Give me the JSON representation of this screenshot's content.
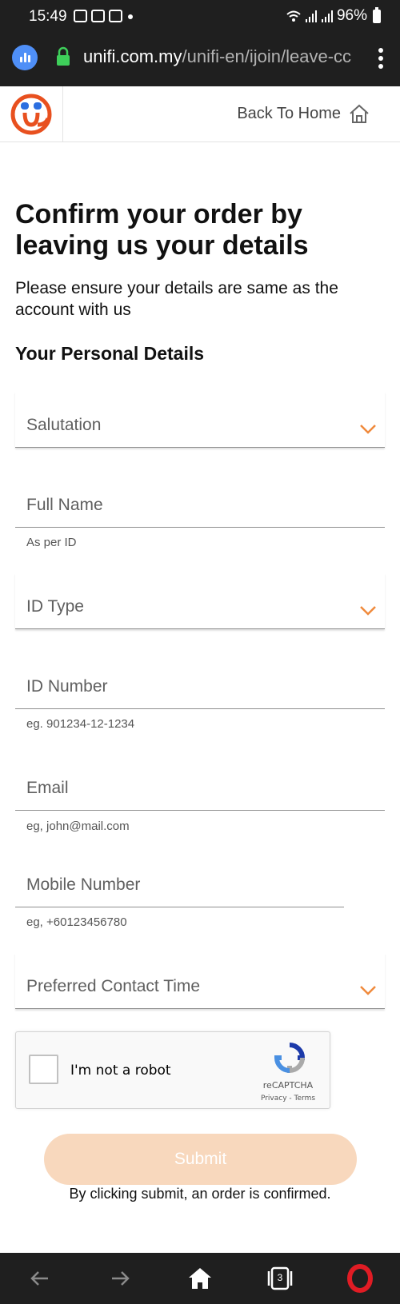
{
  "status_bar": {
    "time": "15:49",
    "battery": "96%"
  },
  "browser": {
    "url_domain": "unifi.com.my",
    "url_path": "/unifi-en/ijoin/leave-cc",
    "tab_count": "3"
  },
  "header": {
    "back_home_label": "Back To Home"
  },
  "page": {
    "title": "Confirm your order by leaving us your details",
    "subtitle": "Please ensure your details are same as the account with us",
    "section_heading": "Your Personal Details"
  },
  "form": {
    "salutation_placeholder": "Salutation",
    "full_name_placeholder": "Full Name",
    "full_name_helper": "As per ID",
    "id_type_placeholder": "ID Type",
    "id_number_placeholder": "ID Number",
    "id_number_helper": "eg. 901234-12-1234",
    "email_placeholder": "Email",
    "email_helper": "eg, john@mail.com",
    "mobile_placeholder": "Mobile Number",
    "mobile_helper": "eg, +60123456780",
    "contact_time_placeholder": "Preferred Contact Time"
  },
  "recaptcha": {
    "label": "I'm not a robot",
    "brand": "reCAPTCHA",
    "privacy": "Privacy",
    "separator": " - ",
    "terms": "Terms"
  },
  "submit_label": "Submit",
  "disclaimer": "By clicking submit, an order is confirmed.",
  "colors": {
    "accent": "#f08a3c",
    "brand_orange": "#e8501f",
    "submit_bg": "#f8d8bd",
    "browser_bar": "#1f1f1f",
    "opera_red": "#e01c24"
  }
}
